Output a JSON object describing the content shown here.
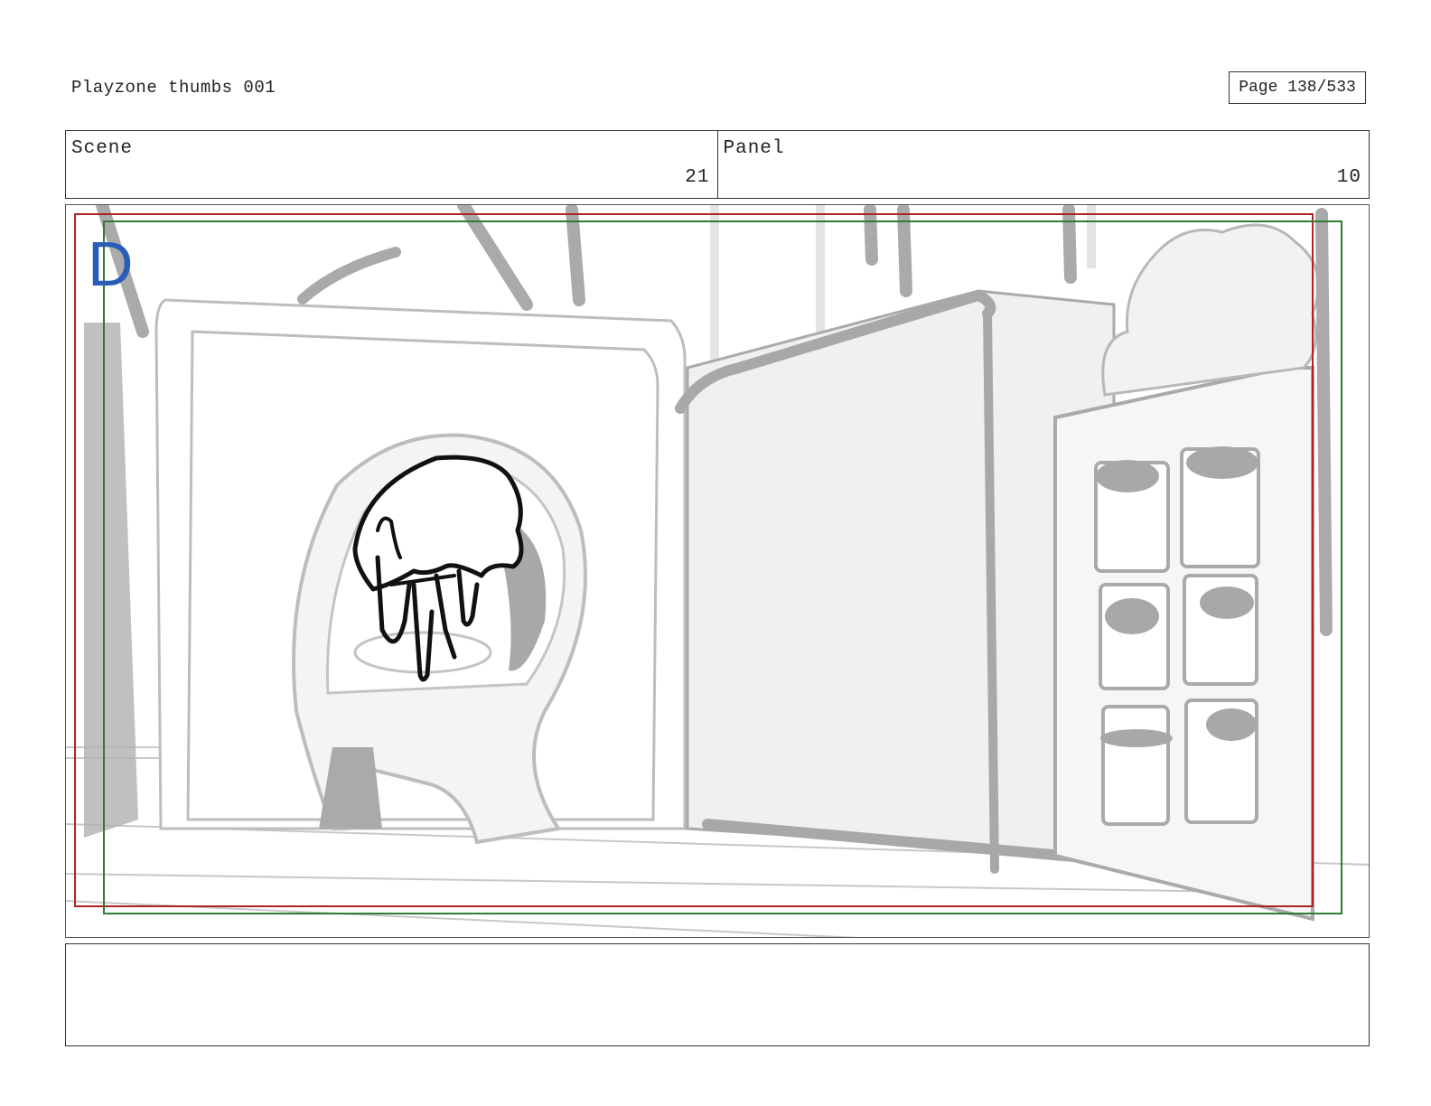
{
  "document": {
    "title": "Playzone thumbs 001",
    "page_label": "Page 138/533"
  },
  "meta": {
    "scene_label": "Scene",
    "scene_value": "21",
    "panel_label": "Panel",
    "panel_value": "10"
  },
  "panel": {
    "letter": "D",
    "safe_frame_color": "#b22222",
    "action_frame_color": "#2e7d32",
    "letter_color": "#2a5db8"
  },
  "notes": {
    "text": ""
  }
}
